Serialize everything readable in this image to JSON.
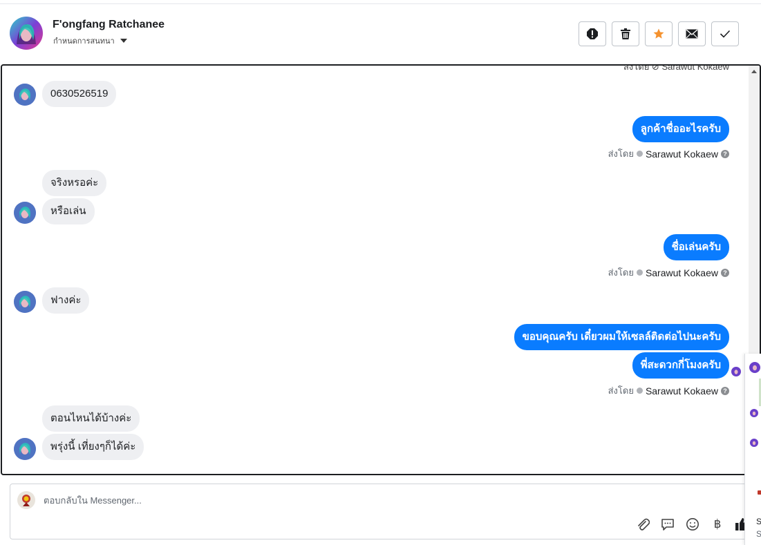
{
  "header": {
    "contact_name": "F'ongfang Ratchanee",
    "assign_label": "กำหนดการสนทนา",
    "actions": [
      {
        "name": "spam-button",
        "icon": "exclamation-icon"
      },
      {
        "name": "delete-button",
        "icon": "trash-icon"
      },
      {
        "name": "star-button",
        "icon": "star-icon"
      },
      {
        "name": "mark-unread-button",
        "icon": "envelope-icon"
      },
      {
        "name": "mark-done-button",
        "icon": "check-icon"
      }
    ]
  },
  "conversation": {
    "cut_text": "ส่งโดย ⊘ Sarawut Kokaew",
    "messages": [
      {
        "side": "in",
        "text": "0630526519"
      },
      {
        "side": "out",
        "text": "ลูกค้าชื่ออะไรครับ"
      },
      {
        "side": "in",
        "text": "จริงหรอค่ะ"
      },
      {
        "side": "in",
        "text": "หรือเล่น"
      },
      {
        "side": "out",
        "text": "ชื่อเล่นครับ"
      },
      {
        "side": "in",
        "text": "ฟางค่ะ"
      },
      {
        "side": "out",
        "text": "ขอบคุณครับ เดี๋ยวผมให้เซลล์ติดต่อไปนะครับ"
      },
      {
        "side": "out",
        "text": "พี่สะดวกกี่โมงครับ"
      },
      {
        "side": "in",
        "text": "ตอนไหนได้บ้างค่ะ"
      },
      {
        "side": "in",
        "text": "พรุ่งนี้ เที่ยงๆก็ได้ค่ะ"
      }
    ],
    "sent_by_label": "ส่งโดย",
    "agent_name": "Sarawut Kokaew"
  },
  "composer": {
    "placeholder": "ตอบกลับใน Messenger..."
  },
  "side_panel": {
    "items": [
      "S",
      "S"
    ]
  },
  "colors": {
    "outgoing_bubble": "#0a7cff",
    "incoming_bubble": "#eeeff2",
    "star": "#f5922f"
  }
}
